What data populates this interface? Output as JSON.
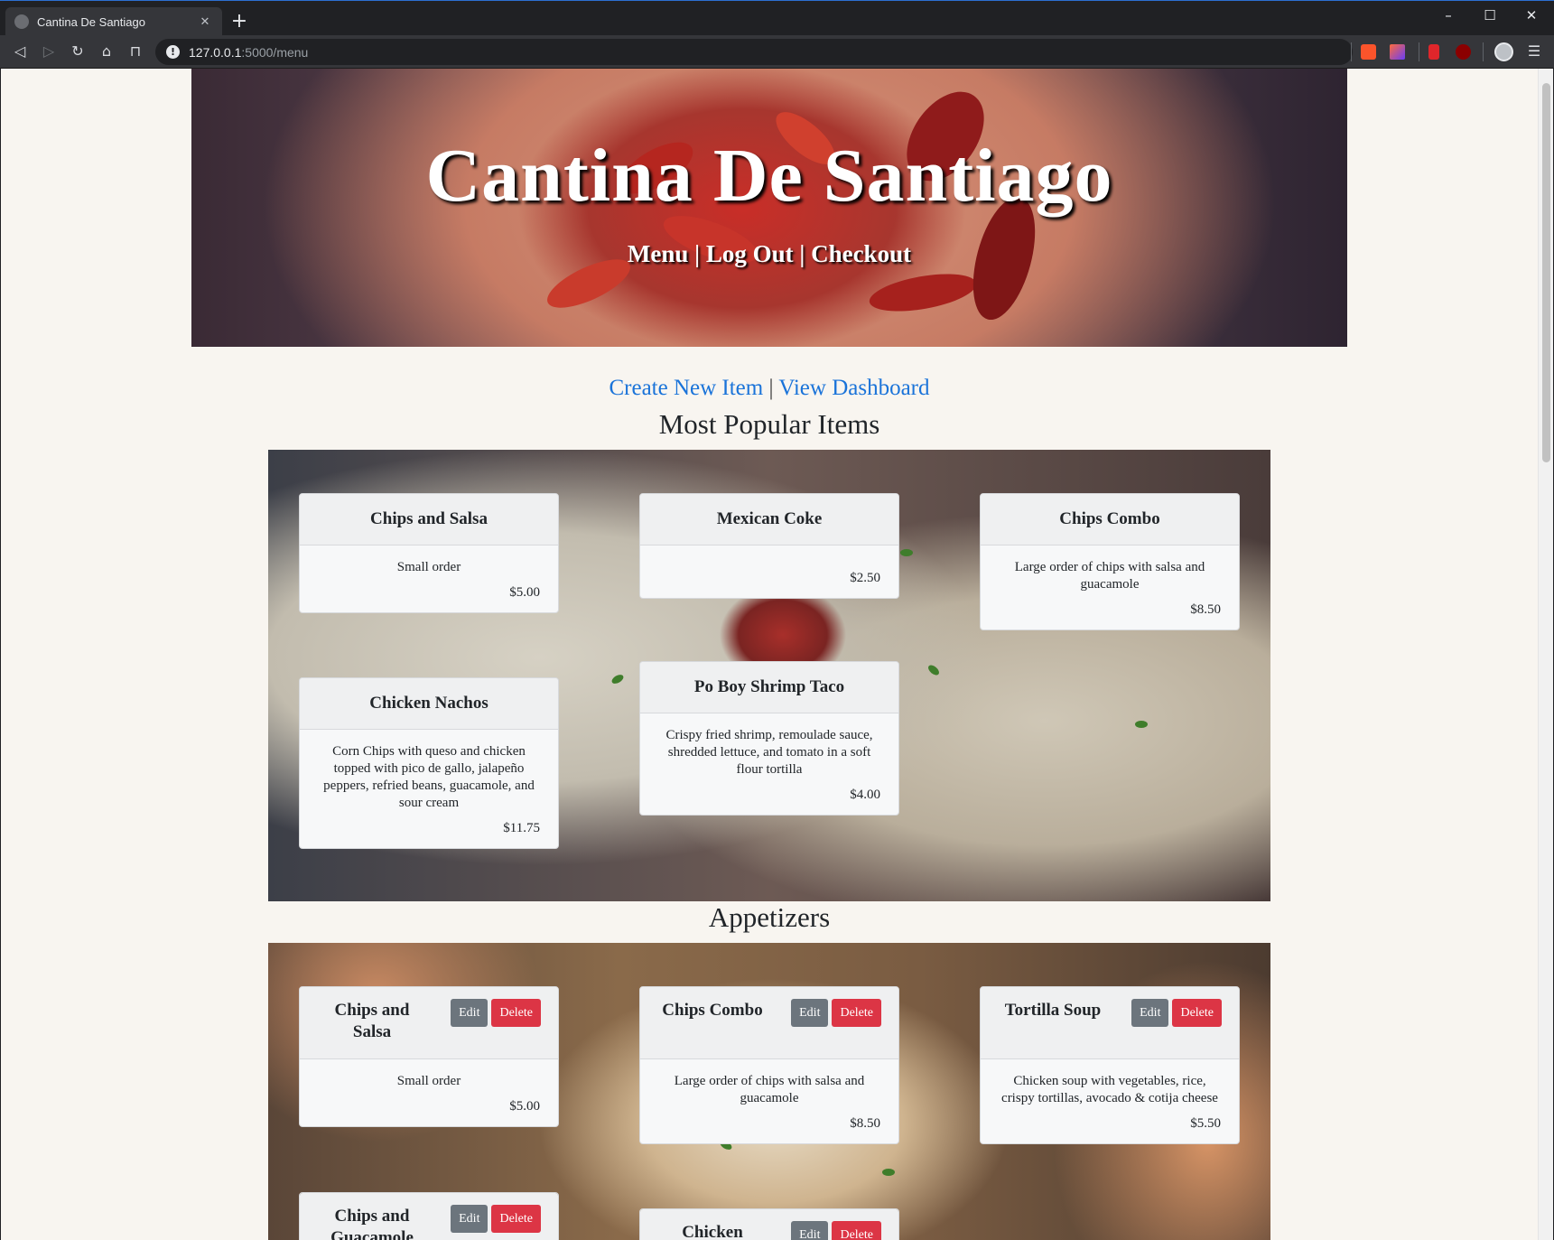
{
  "browser": {
    "tab_title": "Cantina De Santiago",
    "url_host": "127.0.0.1",
    "url_path": ":5000/menu"
  },
  "hero": {
    "title": "Cantina De Santiago",
    "nav": {
      "menu": "Menu",
      "logout": "Log Out",
      "checkout": "Checkout",
      "separator": "|"
    }
  },
  "admin_links": {
    "create": "Create New Item",
    "dashboard": "View Dashboard",
    "separator": "|"
  },
  "popular": {
    "title": "Most Popular Items",
    "items": [
      {
        "name": "Chips and Salsa",
        "desc": "Small order",
        "price": "$5.00"
      },
      {
        "name": "Mexican Coke",
        "desc": "",
        "price": "$2.50"
      },
      {
        "name": "Chips Combo",
        "desc": "Large order of chips with salsa and guacamole",
        "price": "$8.50"
      },
      {
        "name": "Chicken Nachos",
        "desc": "Corn Chips with queso and chicken topped with pico de gallo, jalapeño peppers, refried beans, guacamole, and sour cream",
        "price": "$11.75"
      },
      {
        "name": "Po Boy Shrimp Taco",
        "desc": "Crispy fried shrimp, remoulade sauce, shredded lettuce, and tomato in a soft flour tortilla",
        "price": "$4.00"
      }
    ]
  },
  "appetizers": {
    "title": "Appetizers",
    "edit_label": "Edit",
    "delete_label": "Delete",
    "items": [
      {
        "name": "Chips and Salsa",
        "desc": "Small order",
        "price": "$5.00"
      },
      {
        "name": "Chips Combo",
        "desc": "Large order of chips with salsa and guacamole",
        "price": "$8.50"
      },
      {
        "name": "Tortilla Soup",
        "desc": "Chicken soup with vegetables, rice, crispy tortillas, avocado & cotija cheese",
        "price": "$5.50"
      },
      {
        "name": "Chips and Guacamole",
        "desc": "",
        "price": ""
      },
      {
        "name": "Chicken",
        "desc": "",
        "price": ""
      }
    ]
  },
  "colors": {
    "accent_link": "#1a73d9",
    "edit_button": "#6c757d",
    "delete_button": "#dc3545",
    "page_bg": "#f8f5f0"
  }
}
